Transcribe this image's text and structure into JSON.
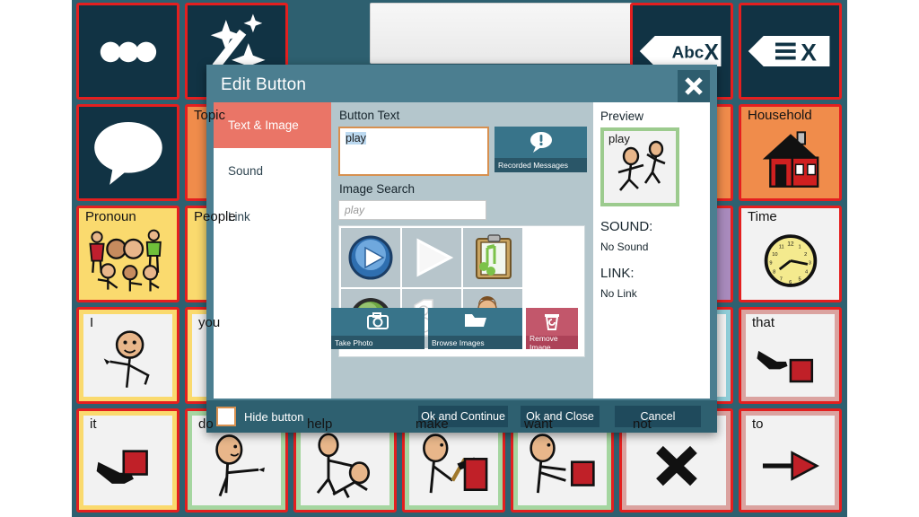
{
  "board": {
    "sentence_bar": {
      "value": ""
    },
    "cells": [
      {
        "name": "more-button",
        "caption": "",
        "scheme": "c-dark",
        "icon": "three-dots-icon"
      },
      {
        "name": "magic-button",
        "caption": "",
        "scheme": "c-dark",
        "icon": "magic-wand-icon"
      },
      {
        "name": "clear-text-button",
        "caption": "",
        "scheme": "c-dark",
        "icon": "abc-x-icon"
      },
      {
        "name": "clear-all-button",
        "caption": "",
        "scheme": "c-dark",
        "icon": "lines-x-icon"
      },
      {
        "name": "speak-button",
        "caption": "",
        "scheme": "c-dark",
        "icon": "speech-bubble-icon"
      },
      {
        "name": "topic-button",
        "caption": "Topic",
        "scheme": "c-orange",
        "icon": "person-icon"
      },
      {
        "name": "household-button",
        "caption": "Household",
        "scheme": "c-orange",
        "icon": "house-icon"
      },
      {
        "name": "pronoun-button",
        "caption": "Pronoun",
        "scheme": "c-yellow",
        "icon": "people-group-icon"
      },
      {
        "name": "people-button",
        "caption": "People",
        "scheme": "c-yellow",
        "icon": "people-icon"
      },
      {
        "name": "time-button",
        "caption": "Time",
        "scheme": "c-white",
        "icon": "clock-icon"
      },
      {
        "name": "i-button",
        "caption": "I",
        "scheme": "in-yellow",
        "icon": "person-pointing-self-icon"
      },
      {
        "name": "you-button",
        "caption": "you",
        "scheme": "in-yellow",
        "icon": "person-pointing-icon"
      },
      {
        "name": "that-button",
        "caption": "that",
        "scheme": "in-pink",
        "icon": "hand-pointing-square-icon"
      },
      {
        "name": "it-button",
        "caption": "it",
        "scheme": "in-yellow",
        "icon": "hand-pointing-square-icon"
      },
      {
        "name": "do-button",
        "caption": "do",
        "scheme": "in-green",
        "icon": "person-doing-icon"
      },
      {
        "name": "help-button",
        "caption": "help",
        "scheme": "in-green",
        "icon": "person-helping-icon"
      },
      {
        "name": "make-button",
        "caption": "make",
        "scheme": "in-green",
        "icon": "person-hammer-icon"
      },
      {
        "name": "want-button",
        "caption": "want",
        "scheme": "in-green",
        "icon": "person-wanting-icon"
      },
      {
        "name": "not-button",
        "caption": "not",
        "scheme": "in-pink",
        "icon": "x-mark-icon"
      },
      {
        "name": "to-button",
        "caption": "to",
        "scheme": "in-pink",
        "icon": "arrow-right-icon"
      }
    ]
  },
  "dialog": {
    "title": "Edit Button",
    "close_label": "×",
    "nav": [
      {
        "label": "Text & Image",
        "active": true
      },
      {
        "label": "Sound",
        "active": false
      },
      {
        "label": "Link",
        "active": false
      }
    ],
    "button_text": {
      "label": "Button Text",
      "value": "play",
      "selected": true
    },
    "recorded_messages": {
      "label": "Recorded Messages",
      "icon": "speech-bubble-exclamation-icon"
    },
    "image_search": {
      "label": "Image Search",
      "value": "",
      "placeholder": "play"
    },
    "results": [
      {
        "name": "result-blue-play-icon",
        "icon": "blue-play-orb"
      },
      {
        "name": "result-white-play-icon",
        "icon": "white-play-triangle"
      },
      {
        "name": "result-music-sheet-icon",
        "icon": "music-clipboard"
      },
      {
        "name": "result-green-play-icon",
        "icon": "green-play-orb"
      },
      {
        "name": "result-speaker-headphones-icon",
        "icon": "speaker-headphones"
      },
      {
        "name": "result-soccer-player-icon",
        "icon": "soccer-player"
      }
    ],
    "actions": [
      {
        "name": "take-photo",
        "label": "Take Photo",
        "icon": "camera-icon"
      },
      {
        "name": "browse-images",
        "label": "Browse Images",
        "icon": "folder-icon"
      },
      {
        "name": "remove-image",
        "label": "Remove Image",
        "icon": "trash-icon"
      }
    ],
    "preview": {
      "title": "Preview",
      "tile_caption": "play",
      "tile_icon": "two-people-playing-icon",
      "sound_heading": "SOUND:",
      "sound_value": "No Sound",
      "link_heading": "LINK:",
      "link_value": "No Link"
    },
    "footer": {
      "hide_button_label": "Hide button",
      "hide_button_checked": false,
      "ok_continue_label": "Ok and Continue",
      "ok_close_label": "Ok and Close",
      "cancel_label": "Cancel"
    }
  },
  "colors": {
    "dialog_header": "#4b7e90",
    "dialog_body": "#b4c6cc",
    "accent_active_nav": "#ea7567",
    "board_bg": "#2e6070",
    "cell_border": "#e41f1f",
    "footer_bg": "#2e6070",
    "remove_button": "#c2576b",
    "preview_border": "#9ccb8e"
  }
}
